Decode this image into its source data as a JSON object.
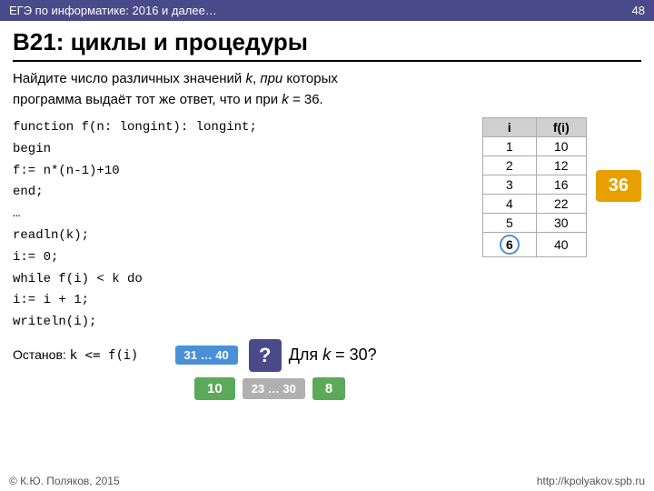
{
  "header": {
    "title": "ЕГЭ по информатике: 2016 и далее…",
    "page_number": "48"
  },
  "slide": {
    "title": "В21: циклы и процедуры",
    "problem_text_line1": "Найдите число различных значений ",
    "problem_k": "k",
    "problem_text_line2": ", ",
    "problem_pri": "при",
    "problem_text_line3": " которых",
    "problem_text_line4": "программа выдаёт тот же ответ, что и при ",
    "problem_k2": "k",
    "problem_text_line5": " = 36."
  },
  "code": {
    "line1": "function f(n: longint): longint;",
    "line2": "begin",
    "line3": "  f:= n*(n-1)+10",
    "line4": "end;",
    "line5": "…",
    "line6": "readln(k);",
    "line7": "i:= 0;",
    "line8": "while f(i) < k do",
    "line9": "  i:= i + 1;",
    "line10": "writeln(i);"
  },
  "table": {
    "headers": [
      "i",
      "f(i)"
    ],
    "rows": [
      [
        "1",
        "10"
      ],
      [
        "2",
        "12"
      ],
      [
        "3",
        "16"
      ],
      [
        "4",
        "22"
      ],
      [
        "5",
        "30"
      ],
      [
        "6",
        "40"
      ]
    ],
    "row6_circle": "6"
  },
  "badge36": "36",
  "bottom": {
    "stop_label": "Останов:",
    "stop_condition": "k <= f(i)",
    "range_label": "31 … 40",
    "question_mark": "?",
    "answer_prefix": "Для ",
    "answer_k": "k",
    "answer_eq": " = 30?",
    "sub_value": "10",
    "sub_range": "23 … 30",
    "sub_count": "8"
  },
  "footer": {
    "left": "© К.Ю. Поляков, 2015",
    "right": "http://kpolyakov.spb.ru"
  }
}
